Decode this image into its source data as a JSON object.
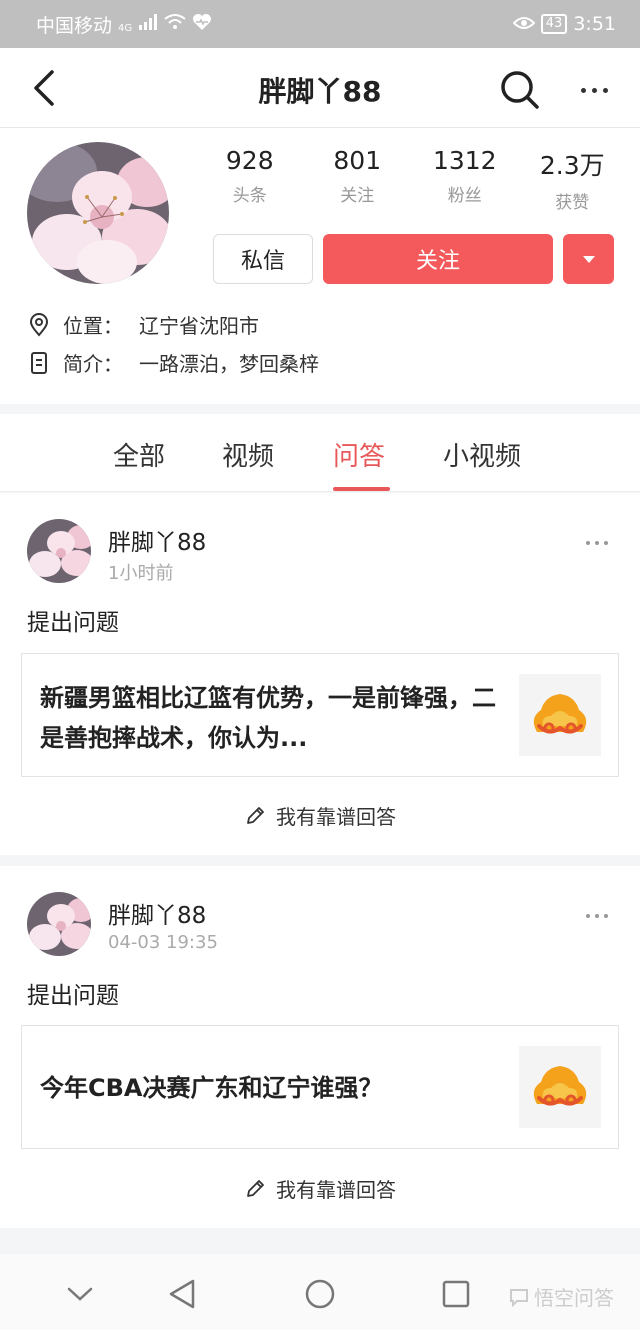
{
  "status_bar": {
    "carrier": "中国移动",
    "network": "4G",
    "battery": "43",
    "time": "3:51"
  },
  "nav": {
    "title": "胖脚丫88"
  },
  "profile": {
    "stats": [
      {
        "value": "928",
        "label": "头条"
      },
      {
        "value": "801",
        "label": "关注"
      },
      {
        "value": "1312",
        "label": "粉丝"
      },
      {
        "value": "2.3万",
        "label": "获赞"
      }
    ],
    "message_label": "私信",
    "follow_label": "关注",
    "location_label": "位置：",
    "location_value": "辽宁省沈阳市",
    "bio_label": "简介：",
    "bio_value": "一路漂泊，梦回桑梓"
  },
  "tabs": [
    {
      "label": "全部",
      "active": false
    },
    {
      "label": "视频",
      "active": false
    },
    {
      "label": "问答",
      "active": true
    },
    {
      "label": "小视频",
      "active": false
    }
  ],
  "posts": [
    {
      "author": "胖脚丫88",
      "time": "1小时前",
      "action": "提出问题",
      "question": "新疆男篮相比辽篮有优势，一是前锋强，二是善抱摔战术，你认为...",
      "answer_label": "我有靠谱回答"
    },
    {
      "author": "胖脚丫88",
      "time": "04-03 19:35",
      "action": "提出问题",
      "question": "今年CBA决赛广东和辽宁谁强？",
      "answer_label": "我有靠谱回答"
    }
  ],
  "watermark": "悟空问答",
  "colors": {
    "accent": "#f45a5c",
    "active_tab": "#e8585a",
    "status_bar": "#bfbfbf"
  }
}
